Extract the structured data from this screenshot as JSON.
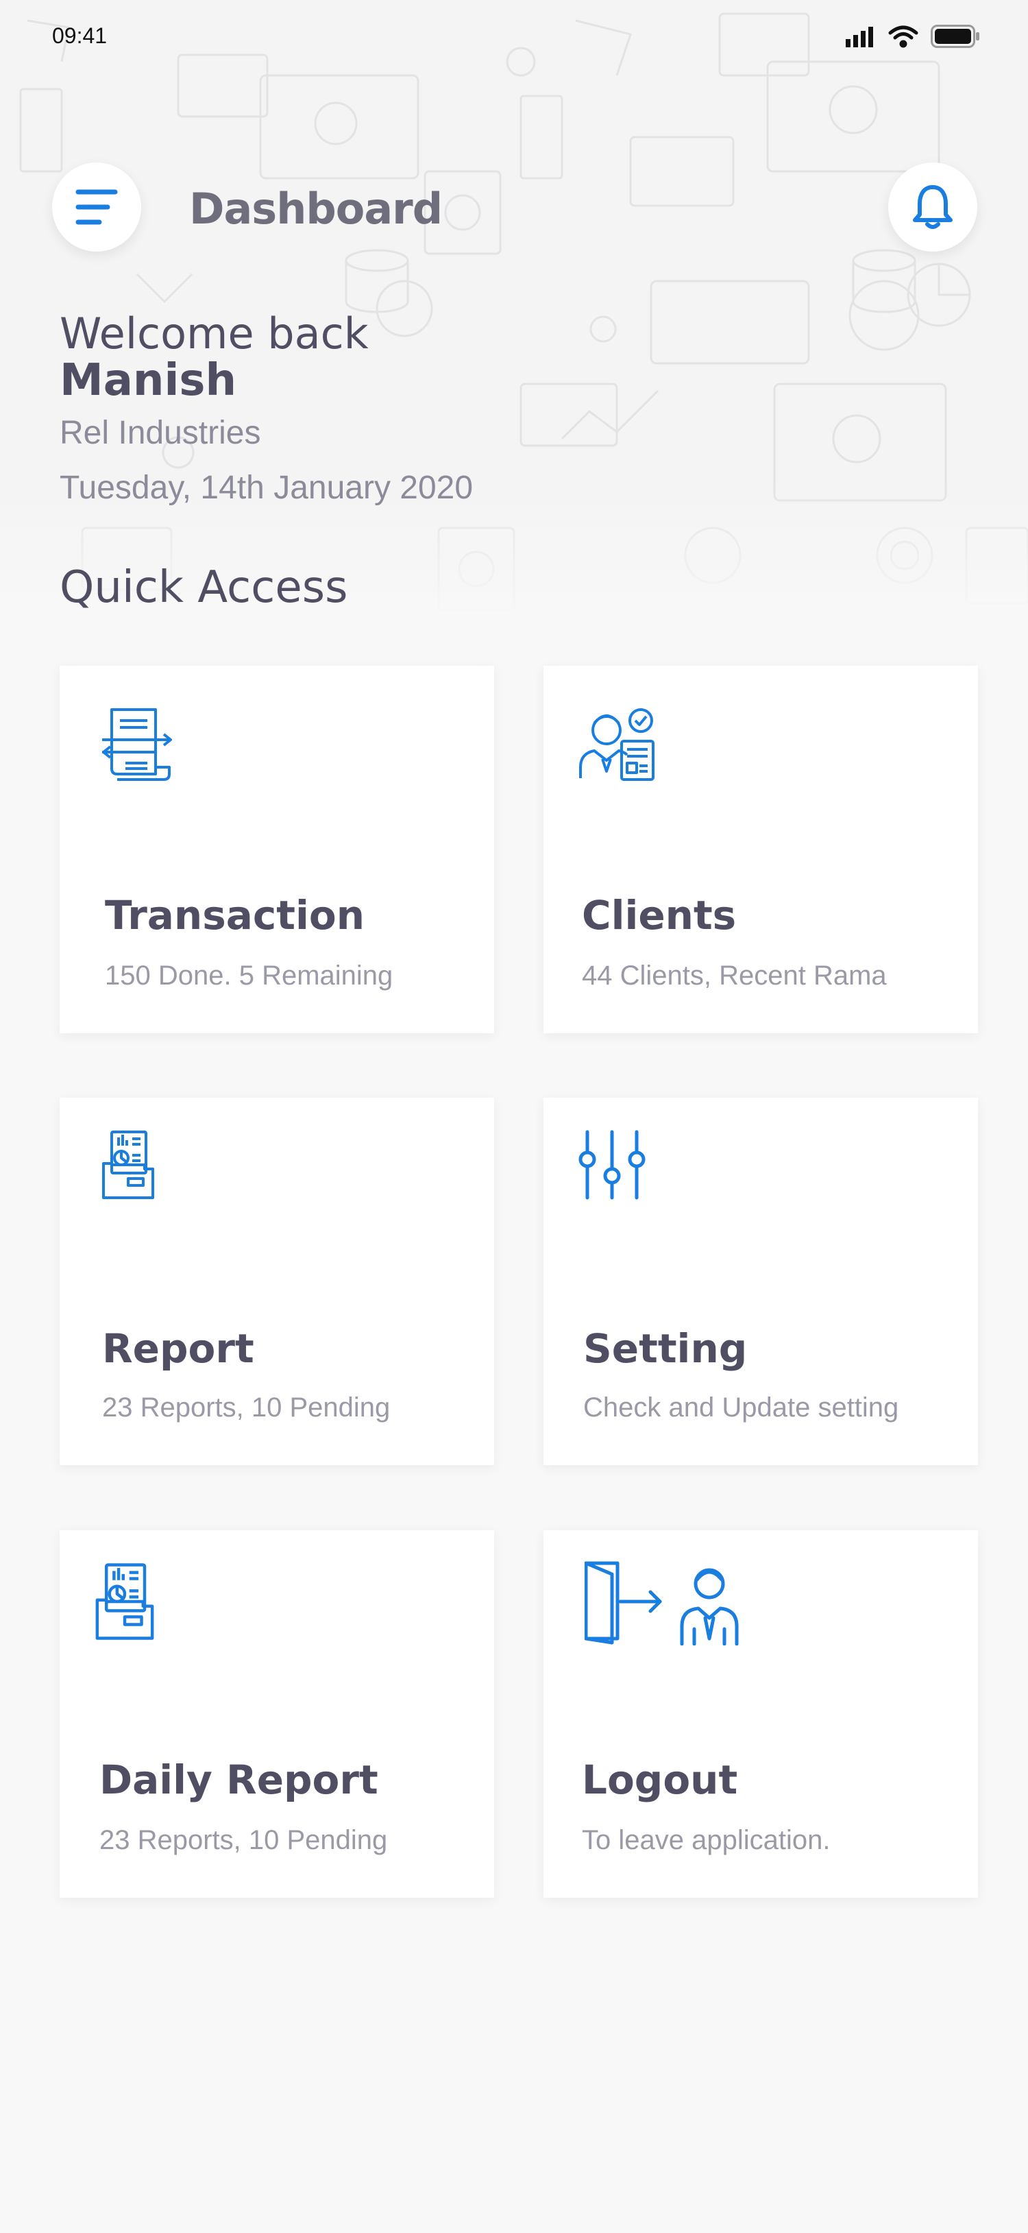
{
  "status_bar": {
    "time": "09:41"
  },
  "header": {
    "title": "Dashboard"
  },
  "greeting": {
    "welcome": "Welcome back",
    "name": "Manish",
    "company": "Rel Industries",
    "date": "Tuesday, 14th January 2020"
  },
  "quick_access": {
    "title": "Quick Access",
    "cards": [
      {
        "title": "Transaction",
        "subtitle": "150 Done. 5 Remaining",
        "icon": "transaction-icon"
      },
      {
        "title": "Clients",
        "subtitle": "44 Clients, Recent Rama",
        "icon": "clients-icon"
      },
      {
        "title": "Report",
        "subtitle": "23 Reports, 10 Pending",
        "icon": "report-icon"
      },
      {
        "title": "Setting",
        "subtitle": "Check and Update setting",
        "icon": "sliders-icon"
      },
      {
        "title": "Daily Report",
        "subtitle": "23 Reports, 10 Pending",
        "icon": "daily-report-icon"
      },
      {
        "title": "Logout",
        "subtitle": "To leave application.",
        "icon": "logout-icon"
      }
    ]
  },
  "colors": {
    "accent": "#1a7de0",
    "text": "#4f4e63",
    "muted": "#9a9aa6",
    "background": "#f8f8f8"
  }
}
